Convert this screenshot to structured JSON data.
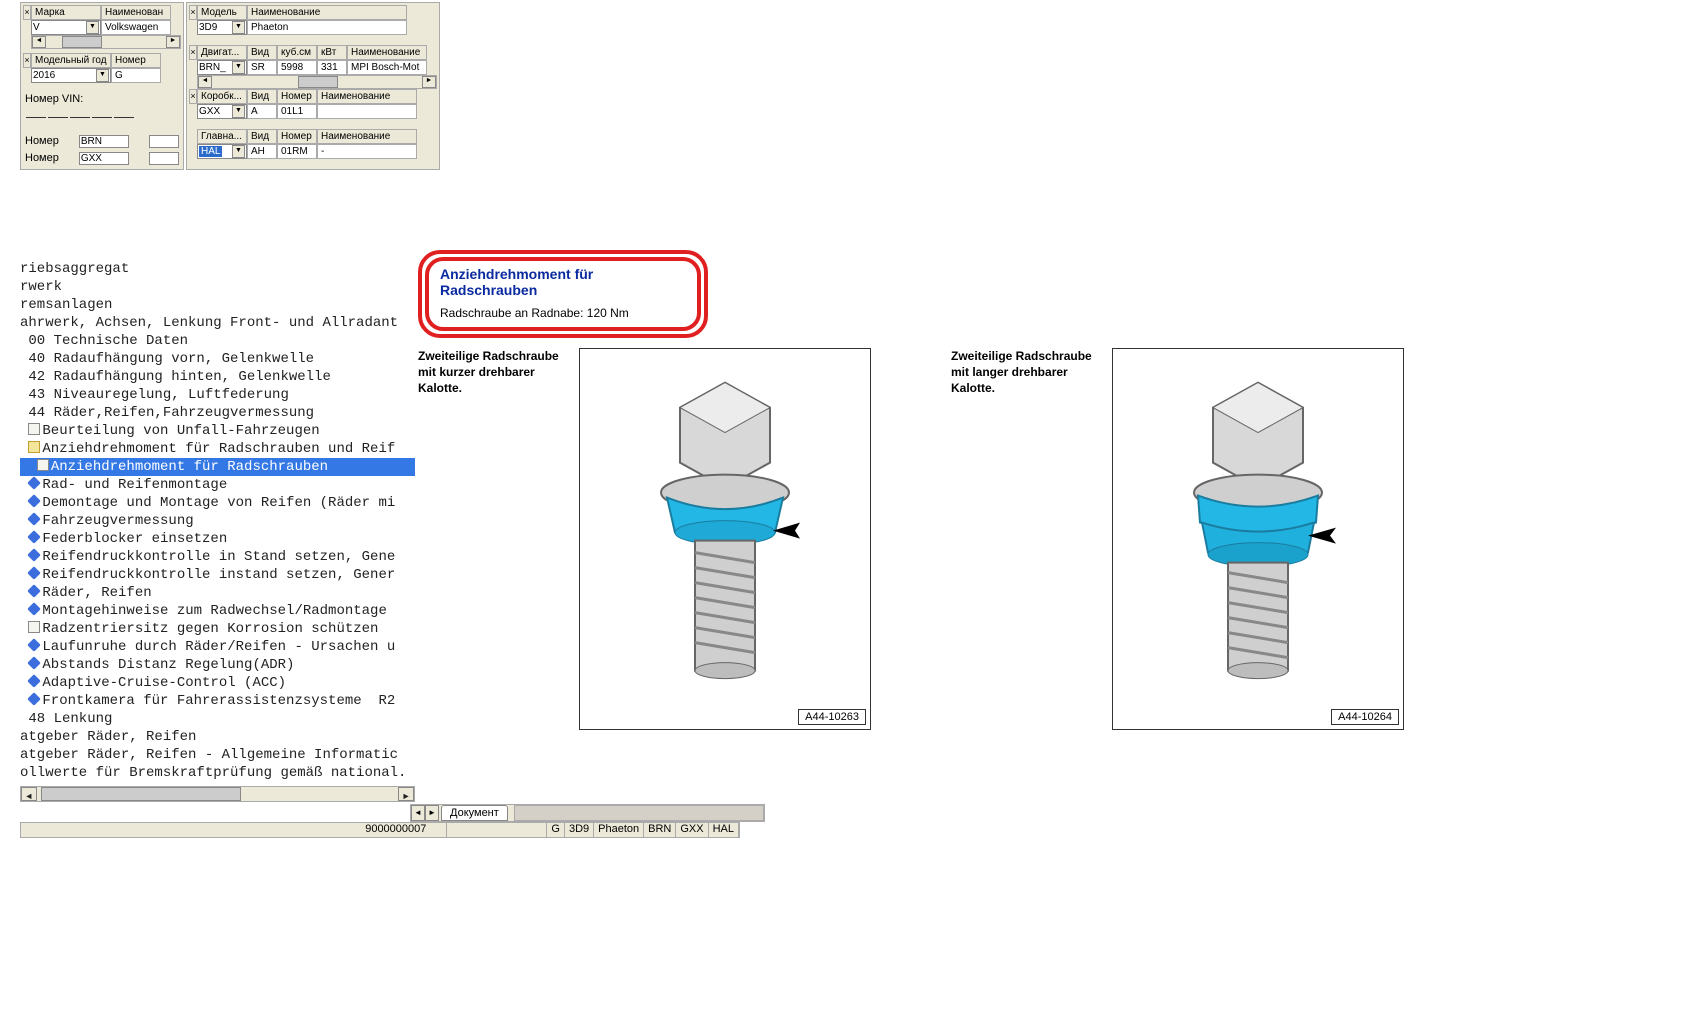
{
  "filters": {
    "brand": {
      "label": "Марка",
      "name_label": "Наименован",
      "value": "V",
      "name_value": "Volkswagen"
    },
    "model": {
      "label": "Модель",
      "name_label": "Наименование",
      "value": "3D9",
      "name_value": "Phaeton"
    },
    "year": {
      "label": "Модельный год",
      "number_label": "Номер",
      "value": "2016",
      "number_value": "G"
    },
    "engine": {
      "label": "Двигат...",
      "type_label": "Вид",
      "cc_label": "куб.см",
      "kw_label": "кВт",
      "name_label": "Наименование",
      "value": "BRN_",
      "type": "SR",
      "cc": "5998",
      "kw": "331",
      "name": "MPI Bosch-Mot"
    },
    "gearbox": {
      "label": "Коробк...",
      "type_label": "Вид",
      "number_label": "Номер",
      "name_label": "Наименование",
      "value": "GXX",
      "type": "A",
      "number": "01L1",
      "name": ""
    },
    "main": {
      "label": "Главна...",
      "type_label": "Вид",
      "number_label": "Номер",
      "name_label": "Наименование",
      "value": "HAL",
      "type": "AH",
      "number": "01RM",
      "name": "-"
    },
    "vin_label": "Номер VIN:",
    "number_label": "Номер",
    "number1_value": "BRN",
    "number2_value": "GXX"
  },
  "tree": [
    {
      "depth": 0,
      "icon": "",
      "text": "riebsaggregat"
    },
    {
      "depth": 0,
      "icon": "",
      "text": "rwerk"
    },
    {
      "depth": 0,
      "icon": "",
      "text": "remsanlagen"
    },
    {
      "depth": 0,
      "icon": "",
      "text": "ahrwerk, Achsen, Lenkung Front- und Allradant"
    },
    {
      "depth": 0,
      "icon": "",
      "text": " 00 Technische Daten"
    },
    {
      "depth": 0,
      "icon": "",
      "text": " 40 Radaufhängung vorn, Gelenkwelle"
    },
    {
      "depth": 0,
      "icon": "",
      "text": " 42 Radaufhängung hinten, Gelenkwelle"
    },
    {
      "depth": 0,
      "icon": "",
      "text": " 43 Niveauregelung, Luftfederung"
    },
    {
      "depth": 0,
      "icon": "",
      "text": " 44 Räder,Reifen,Fahrzeugvermessung"
    },
    {
      "depth": 1,
      "icon": "doc",
      "text": "Beurteilung von Unfall-Fahrzeugen"
    },
    {
      "depth": 1,
      "icon": "folder",
      "text": "Anziehdrehmoment für Radschrauben und Reif"
    },
    {
      "depth": 2,
      "icon": "doc",
      "text": "Anziehdrehmoment für Radschrauben",
      "selected": true
    },
    {
      "depth": 1,
      "icon": "blue",
      "text": "Rad- und Reifenmontage"
    },
    {
      "depth": 1,
      "icon": "blue",
      "text": "Demontage und Montage von Reifen (Räder mi"
    },
    {
      "depth": 1,
      "icon": "blue",
      "text": "Fahrzeugvermessung"
    },
    {
      "depth": 1,
      "icon": "blue",
      "text": "Federblocker einsetzen"
    },
    {
      "depth": 1,
      "icon": "blue",
      "text": "Reifendruckkontrolle in Stand setzen, Gene"
    },
    {
      "depth": 1,
      "icon": "blue",
      "text": "Reifendruckkontrolle instand setzen, Gener"
    },
    {
      "depth": 1,
      "icon": "blue",
      "text": "Räder, Reifen"
    },
    {
      "depth": 1,
      "icon": "blue",
      "text": "Montagehinweise zum Radwechsel/Radmontage"
    },
    {
      "depth": 1,
      "icon": "doc",
      "text": "Radzentriersitz gegen Korrosion schützen"
    },
    {
      "depth": 1,
      "icon": "blue",
      "text": "Laufunruhe durch Räder/Reifen - Ursachen u"
    },
    {
      "depth": 1,
      "icon": "blue",
      "text": "Abstands Distanz Regelung(ADR)"
    },
    {
      "depth": 1,
      "icon": "blue",
      "text": "Adaptive-Cruise-Control (ACC)"
    },
    {
      "depth": 1,
      "icon": "blue",
      "text": "Frontkamera für Fahrerassistenzsysteme  R2"
    },
    {
      "depth": 0,
      "icon": "",
      "text": " 48 Lenkung"
    },
    {
      "depth": 0,
      "icon": "",
      "text": "atgeber Räder, Reifen"
    },
    {
      "depth": 0,
      "icon": "",
      "text": "atgeber Räder, Reifen - Allgemeine Informatic"
    },
    {
      "depth": 0,
      "icon": "",
      "text": "ollwerte für Bremskraftprüfung gemäß national."
    }
  ],
  "document": {
    "title": "Anziehdrehmoment für Radschrauben",
    "subtitle": "Radschraube an Radnabe: 120 Nm",
    "diagram1_caption": "Zweiteilige Radschraube mit kurzer drehbarer Kalotte.",
    "diagram1_id": "A44-10263",
    "diagram2_caption": "Zweiteilige Radschraube mit langer drehbarer Kalotte.",
    "diagram2_id": "A44-10264"
  },
  "tabs": {
    "document": "Документ"
  },
  "status": {
    "code": "9000000007",
    "items": [
      "G",
      "3D9",
      "Phaeton",
      "BRN",
      "GXX",
      "HAL"
    ]
  }
}
